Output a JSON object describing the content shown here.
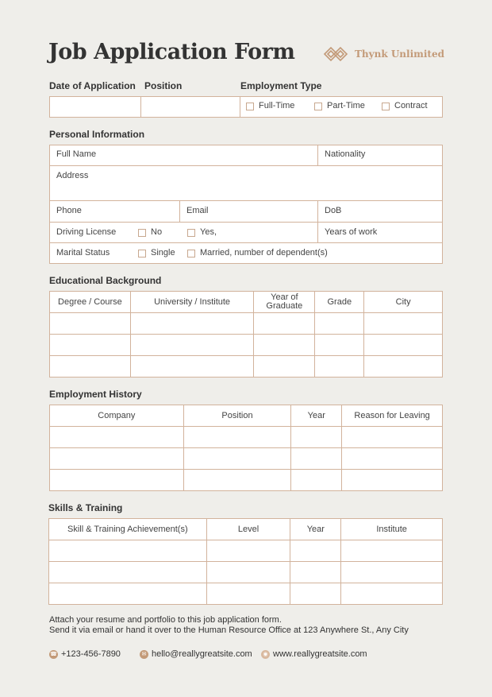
{
  "header": {
    "title": "Job Application Form",
    "brand_name": "Thynk Unlimited",
    "brand_icon": "interlocking-diamonds-logo"
  },
  "top_fields": {
    "date_label": "Date of Application",
    "position_label": "Position",
    "employment_type_label": "Employment Type",
    "employment_options": [
      "Full-Time",
      "Part-Time",
      "Contract"
    ]
  },
  "personal": {
    "heading": "Personal Information",
    "full_name": "Full Name",
    "nationality": "Nationality",
    "address": "Address",
    "phone": "Phone",
    "email": "Email",
    "dob": "DoB",
    "driving_license": "Driving License",
    "dl_no": "No",
    "dl_yes": "Yes,",
    "years_of_work": "Years of work",
    "marital_status": "Marital Status",
    "single": "Single",
    "married": "Married, number of dependent(s)"
  },
  "education": {
    "heading": "Educational Background",
    "columns": [
      "Degree / Course",
      "University / Institute",
      "Year of Graduate",
      "Grade",
      "City"
    ],
    "rows": [
      [
        "",
        "",
        "",
        "",
        ""
      ],
      [
        "",
        "",
        "",
        "",
        ""
      ],
      [
        "",
        "",
        "",
        "",
        ""
      ]
    ]
  },
  "employment": {
    "heading": "Employment History",
    "columns": [
      "Company",
      "Position",
      "Year",
      "Reason for Leaving"
    ],
    "rows": [
      [
        "",
        "",
        "",
        ""
      ],
      [
        "",
        "",
        "",
        ""
      ],
      [
        "",
        "",
        "",
        ""
      ]
    ]
  },
  "skills": {
    "heading": "Skills & Training",
    "columns": [
      "Skill & Training Achievement(s)",
      "Level",
      "Year",
      "Institute"
    ],
    "rows": [
      [
        "",
        "",
        "",
        ""
      ],
      [
        "",
        "",
        "",
        ""
      ],
      [
        "",
        "",
        "",
        ""
      ]
    ]
  },
  "footer": {
    "line1": "Attach your resume and portfolio to this job application form.",
    "line2": "Send it via email or hand it over to the Human Resource Office at 123 Anywhere St., Any City",
    "phone": "+123-456-7890",
    "email": "hello@reallygreatsite.com",
    "website": "www.reallygreatsite.com"
  },
  "colors": {
    "accent": "#c39a78",
    "border": "#d2b39c",
    "background": "#efeeea"
  }
}
